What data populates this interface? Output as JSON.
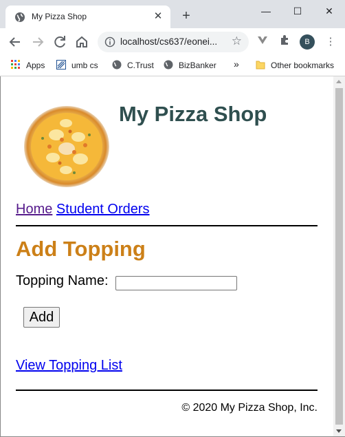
{
  "browser": {
    "tab_title": "My Pizza Shop",
    "tab_close": "✕",
    "new_tab": "+",
    "window_minimize": "—",
    "window_maximize": "☐",
    "window_close": "✕",
    "url": "localhost/cs637/eonei...",
    "profile_initial": "B",
    "bookmarks": {
      "apps": "Apps",
      "umb": "umb cs",
      "ctrust": "C.Trust",
      "bizbanker": "BizBanker",
      "overflow": "»",
      "other": "Other bookmarks"
    },
    "colors": {
      "accent_profile": "#35505c",
      "tab_strip": "#dee1e6"
    }
  },
  "page": {
    "shop_title": "My Pizza Shop",
    "nav": {
      "home": "Home",
      "student_orders": "Student Orders"
    },
    "heading": "Add Topping",
    "form": {
      "topping_label": "Topping Name:",
      "topping_value": "",
      "add_label": "Add"
    },
    "view_link": "View Topping List",
    "footer": "© 2020 My Pizza Shop, Inc.",
    "colors": {
      "title": "#2f4f4f",
      "heading": "#cc8018",
      "link": "#0000ee",
      "visited_link": "#551a8b"
    }
  }
}
